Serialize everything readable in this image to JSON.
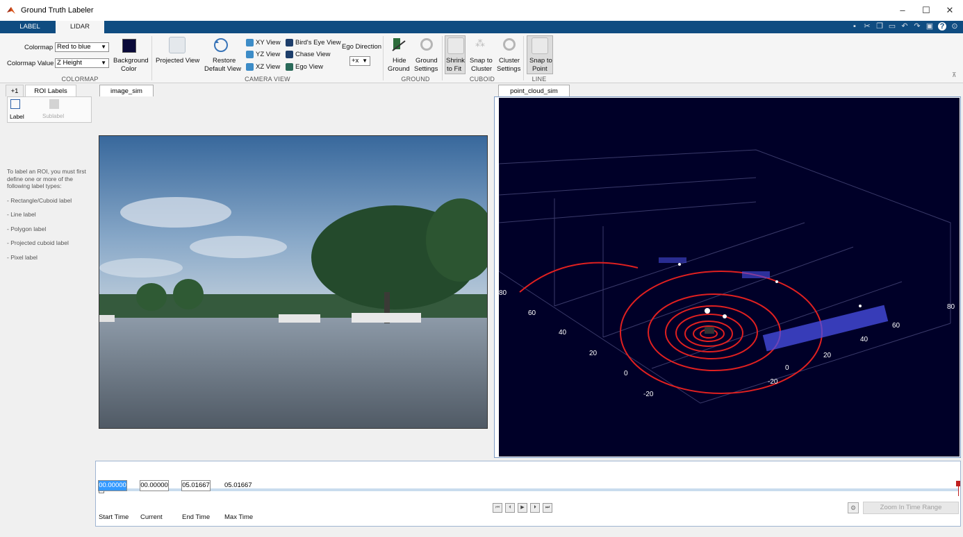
{
  "window": {
    "title": "Ground Truth Labeler",
    "minimize": "–",
    "maximize": "☐",
    "close": "✕"
  },
  "tabs": [
    {
      "label": "LABEL"
    },
    {
      "label": "LIDAR"
    }
  ],
  "ribbon": {
    "colormap": {
      "colormap_label": "Colormap",
      "colormap_value": "Red to blue",
      "colormap_value_label": "Colormap Value",
      "colormap_value_value": "Z Height",
      "background_label_1": "Background",
      "background_label_2": "Color",
      "background_color": "#0a0a3a",
      "section": "COLORMAP"
    },
    "camera": {
      "projected_view": "Projected View",
      "restore_1": "Restore",
      "restore_2": "Default View",
      "xy_view": "XY View",
      "yz_view": "YZ View",
      "xz_view": "XZ View",
      "birds_eye_view": "Bird's Eye View",
      "chase_view": "Chase View",
      "ego_view": "Ego View",
      "ego_direction": "Ego Direction",
      "ego_direction_value": "+x",
      "section": "CAMERA VIEW"
    },
    "ground": {
      "hide_1": "Hide",
      "hide_2": "Ground",
      "settings_1": "Ground",
      "settings_2": "Settings",
      "section": "GROUND"
    },
    "cuboid": {
      "shrink_1": "Shrink",
      "shrink_2": "to Fit",
      "snap_1": "Snap to",
      "snap_2": "Cluster",
      "cluster_1": "Cluster",
      "cluster_2": "Settings",
      "section": "CUBOID"
    },
    "line": {
      "snap_1": "Snap to",
      "snap_2": "Point",
      "section": "LINE"
    }
  },
  "left_panel": {
    "plus_tab": "+1",
    "roi_tab": "ROI Labels",
    "label_button": "Label",
    "sublabel_button": "Sublabel",
    "help_intro": "To label an ROI, you must first define one or more of the following label types:",
    "help_items": [
      "- Rectangle/Cuboid label",
      "- Line label",
      "- Polygon label",
      "- Projected cuboid label",
      "- Pixel label"
    ]
  },
  "image_tab": "image_sim",
  "pointcloud_tab": "point_cloud_sim",
  "pointcloud_axes": {
    "x_ticks": [
      "-20",
      "0",
      "20",
      "40",
      "60",
      "80"
    ],
    "y_ticks": [
      "-20",
      "0",
      "20",
      "40",
      "60",
      "80"
    ]
  },
  "timeline": {
    "start_time": "00.00000",
    "current": "00.00000",
    "end_time": "05.01667",
    "max_time": "05.01667",
    "start_label": "Start Time",
    "current_label": "Current",
    "end_label": "End Time",
    "max_label": "Max Time",
    "zoom_button": "Zoom In Time Range"
  }
}
